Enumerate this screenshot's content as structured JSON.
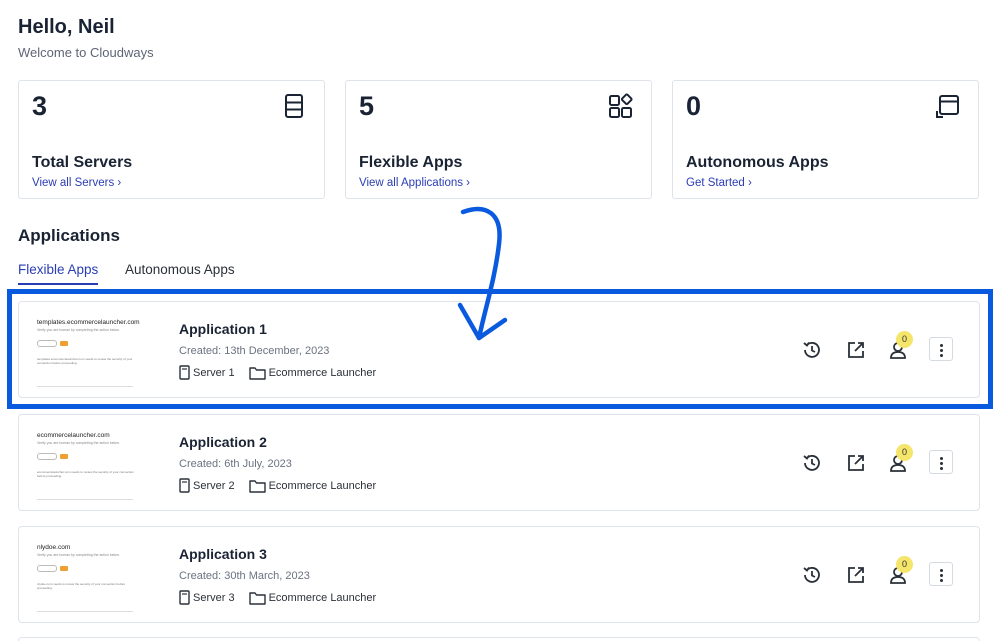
{
  "greeting": {
    "title": "Hello, Neil",
    "subtitle": "Welcome to Cloudways"
  },
  "stats": [
    {
      "value": "3",
      "label": "Total Servers",
      "link": "View all Servers ›",
      "icon": "server-icon"
    },
    {
      "value": "5",
      "label": "Flexible Apps",
      "link": "View all Applications ›",
      "icon": "apps-grid-icon"
    },
    {
      "value": "0",
      "label": "Autonomous Apps",
      "link": "Get Started ›",
      "icon": "window-expand-icon"
    }
  ],
  "applications": {
    "title": "Applications",
    "tabs": [
      {
        "label": "Flexible Apps",
        "active": true
      },
      {
        "label": "Autonomous Apps",
        "active": false
      }
    ],
    "items": [
      {
        "name": "Application 1",
        "created": "Created: 13th December, 2023",
        "server": "Server 1",
        "project": "Ecommerce Launcher",
        "collaborators": "0",
        "thumb_url": "templates.ecommercelauncher.com",
        "thumb_sub": "Verify you are human by completing the action below.",
        "thumb_text": "templates.ecommercelauncher.com needs to review the security of your connection before proceeding."
      },
      {
        "name": "Application 2",
        "created": "Created: 6th July, 2023",
        "server": "Server 2",
        "project": "Ecommerce Launcher",
        "collaborators": "0",
        "thumb_url": "ecommercelauncher.com",
        "thumb_sub": "Verify you are human by completing the action below.",
        "thumb_text": "ecommercelauncher.com needs to review the security of your connection before proceeding."
      },
      {
        "name": "Application 3",
        "created": "Created: 30th March, 2023",
        "server": "Server 3",
        "project": "Ecommerce Launcher",
        "collaborators": "0",
        "thumb_url": "nlydoe.com",
        "thumb_sub": "Verify you are human by completing the action below.",
        "thumb_text": "nlydoe.com needs to review the security of your connection before proceeding."
      }
    ]
  },
  "colors": {
    "accent": "#2a3db3",
    "highlight": "#0a5ae0",
    "badge": "#f6e56b",
    "text": "#1a2333"
  }
}
